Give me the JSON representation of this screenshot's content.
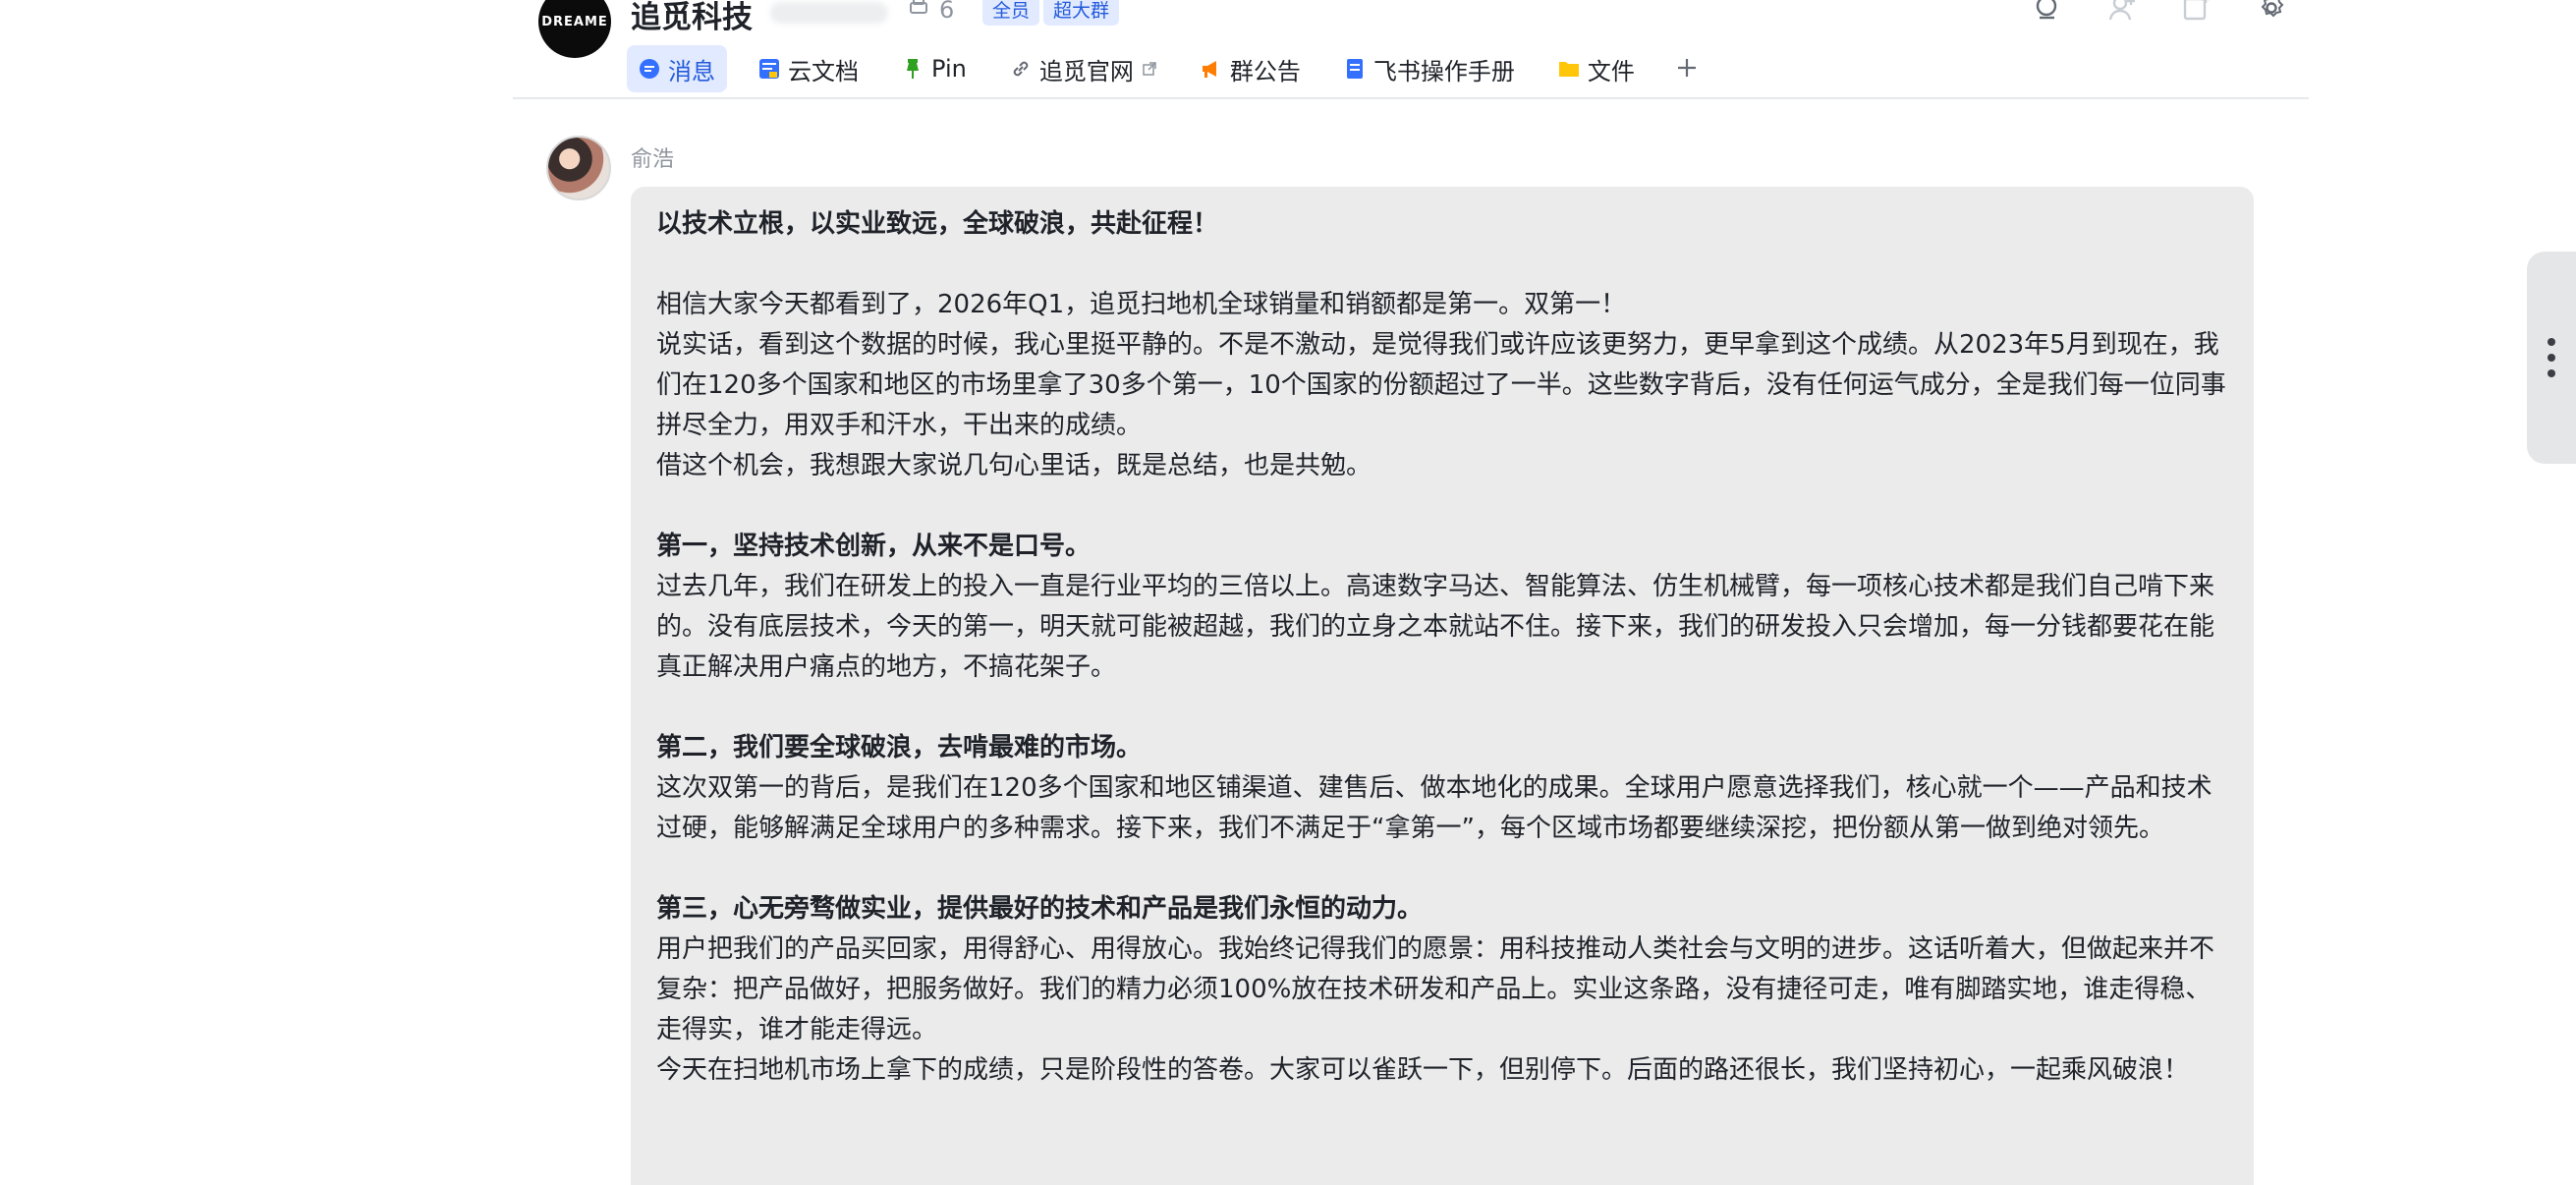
{
  "header": {
    "group_logo": "DREAME",
    "group_name": "追觅科技",
    "member_count": "6",
    "tags": [
      "全员",
      "超大群"
    ]
  },
  "tabs": [
    {
      "label": "消息",
      "icon": "message-bubble-icon",
      "active": true
    },
    {
      "label": "云文档",
      "icon": "cloud-doc-icon"
    },
    {
      "label": "Pin",
      "icon": "pin-icon"
    },
    {
      "label": "追觅官网",
      "icon": "link-icon",
      "external": true
    },
    {
      "label": "群公告",
      "icon": "megaphone-icon"
    },
    {
      "label": "飞书操作手册",
      "icon": "doc-icon"
    },
    {
      "label": "文件",
      "icon": "folder-icon"
    }
  ],
  "message": {
    "sender": "俞浩",
    "lines": [
      {
        "text": "以技术立根，以实业致远，全球破浪，共赴征程！",
        "bold": true
      },
      {
        "text": "",
        "gap": true
      },
      {
        "text": "相信大家今天都看到了，2026年Q1，追觅扫地机全球销量和销额都是第一。双第一！"
      },
      {
        "text": "说实话，看到这个数据的时候，我心里挺平静的。不是不激动，是觉得我们或许应该更努力，更早拿到这个成绩。从2023年5月到现在，我们在120多个国家和地区的市场里拿了30多个第一，10个国家的份额超过了一半。这些数字背后，没有任何运气成分，全是我们每一位同事拼尽全力，用双手和汗水，干出来的成绩。"
      },
      {
        "text": "借这个机会，我想跟大家说几句心里话，既是总结，也是共勉。"
      },
      {
        "text": "",
        "gap": true
      },
      {
        "text": "第一，坚持技术创新，从来不是口号。",
        "bold": true
      },
      {
        "text": "过去几年，我们在研发上的投入一直是行业平均的三倍以上。高速数字马达、智能算法、仿生机械臂，每一项核心技术都是我们自己啃下来的。没有底层技术，今天的第一，明天就可能被超越，我们的立身之本就站不住。接下来，我们的研发投入只会增加，每一分钱都要花在能真正解决用户痛点的地方，不搞花架子。"
      },
      {
        "text": "",
        "gap": true
      },
      {
        "text": "第二，我们要全球破浪，去啃最难的市场。",
        "bold": true
      },
      {
        "text": "这次双第一的背后，是我们在120多个国家和地区铺渠道、建售后、做本地化的成果。全球用户愿意选择我们，核心就一个——产品和技术过硬，能够解满足全球用户的多种需求。接下来，我们不满足于“拿第一”，每个区域市场都要继续深挖，把份额从第一做到绝对领先。"
      },
      {
        "text": "",
        "gap": true
      },
      {
        "text": "第三，心无旁骛做实业，提供最好的技术和产品是我们永恒的动力。",
        "bold": true
      },
      {
        "text": "用户把我们的产品买回家，用得舒心、用得放心。我始终记得我们的愿景：用科技推动人类社会与文明的进步。这话听着大，但做起来并不复杂：把产品做好，把服务做好。我们的精力必须100%放在技术研发和产品上。实业这条路，没有捷径可走，唯有脚踏实地，谁走得稳、走得实，谁才能走得远。"
      },
      {
        "text": "今天在扫地机市场上拿下的成绩，只是阶段性的答卷。大家可以雀跃一下，但别停下。后面的路还很长，我们坚持初心，一起乘风破浪！"
      }
    ]
  }
}
